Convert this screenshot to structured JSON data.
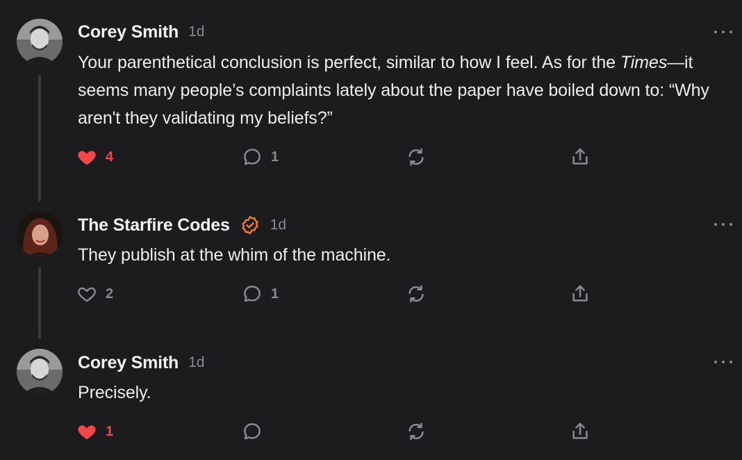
{
  "colors": {
    "background": "#1c1c1f",
    "text": "#ededed",
    "muted": "#8a8a8e",
    "liked": "#f0484a",
    "verified": "#f07a2c",
    "thread_line": "#3a3a3d"
  },
  "comments": [
    {
      "author": "Corey Smith",
      "time": "1d",
      "verified": false,
      "body_part1": "Your parenthetical conclusion is perfect, similar to how I feel. As for the ",
      "body_italic": "Times",
      "body_part2": "—it seems many people’s complaints lately about the paper have boiled down to: “Why aren't they validating my beliefs?”",
      "likes": "4",
      "liked": true,
      "replies": "1",
      "icons": {
        "like": "heart-filled-icon",
        "reply": "speech-bubble-icon",
        "restack": "restack-icon",
        "share": "share-icon",
        "more": "more-dots-icon"
      }
    },
    {
      "author": "The Starfire Codes",
      "time": "1d",
      "verified": true,
      "body": "They publish at the whim of the machine.",
      "likes": "2",
      "liked": false,
      "replies": "1",
      "icons": {
        "like": "heart-outline-icon",
        "reply": "speech-bubble-icon",
        "restack": "restack-icon",
        "share": "share-icon",
        "verified": "verified-badge-icon",
        "more": "more-dots-icon"
      }
    },
    {
      "author": "Corey Smith",
      "time": "1d",
      "verified": false,
      "body": "Precisely.",
      "likes": "1",
      "liked": true,
      "replies": "",
      "icons": {
        "like": "heart-filled-icon",
        "reply": "speech-bubble-icon",
        "restack": "restack-icon",
        "share": "share-icon",
        "more": "more-dots-icon"
      }
    }
  ]
}
